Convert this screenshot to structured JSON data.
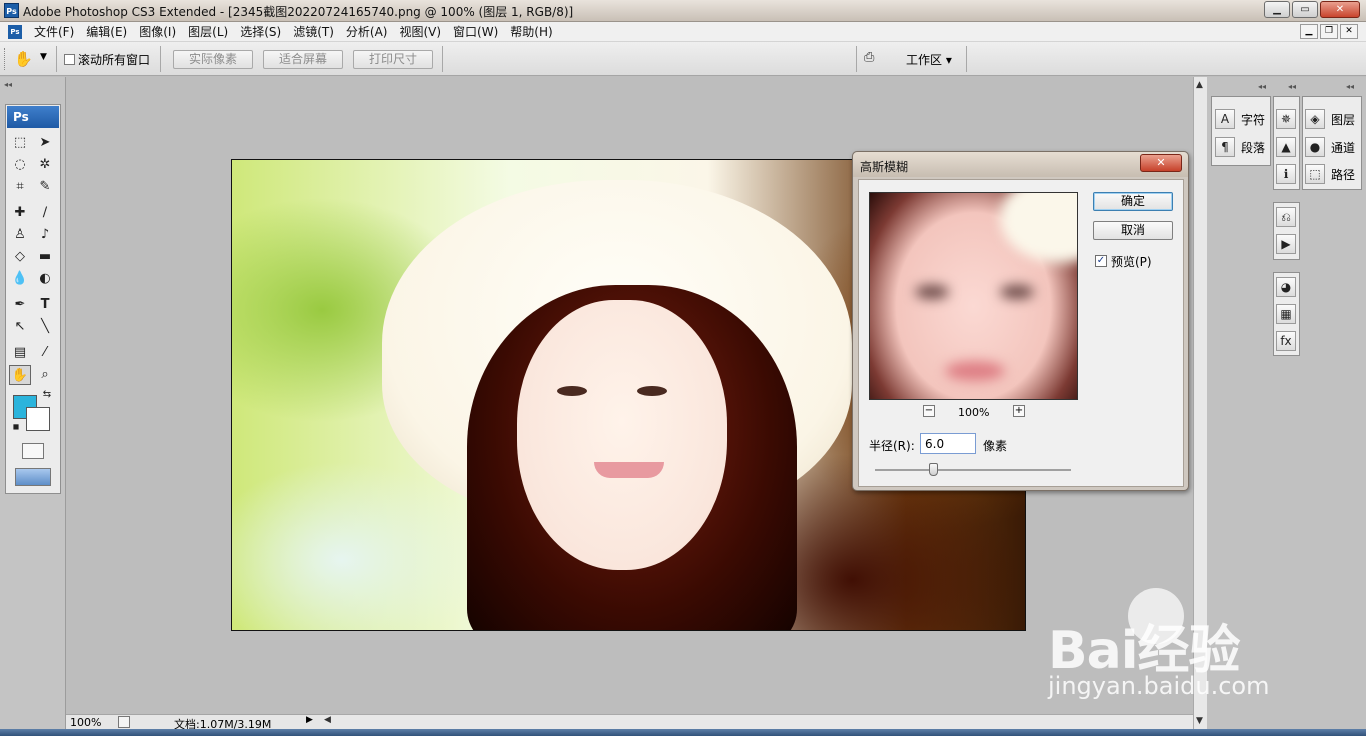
{
  "window": {
    "title": "Adobe Photoshop CS3 Extended - [2345截图20220724165740.png @ 100% (图层 1, RGB/8)]",
    "logo": "Ps"
  },
  "menu": [
    "文件(F)",
    "编辑(E)",
    "图像(I)",
    "图层(L)",
    "选择(S)",
    "滤镜(T)",
    "分析(A)",
    "视图(V)",
    "窗口(W)",
    "帮助(H)"
  ],
  "options": {
    "scroll_all": "滚动所有窗口",
    "actual_pixels": "实际像素",
    "fit_screen": "适合屏幕",
    "print_size": "打印尺寸",
    "workspace": "工作区 ▾"
  },
  "toolbox": {
    "title": "Ps",
    "foreground_color": "#2bb4dc",
    "background_color": "#ffffff"
  },
  "status": {
    "zoom": "100%",
    "doc": "文档:1.07M/3.19M"
  },
  "panels": {
    "character": "字符",
    "paragraph": "段落",
    "layers": "图层",
    "channels": "通道",
    "paths": "路径"
  },
  "dialog": {
    "title": "高斯模糊",
    "ok": "确定",
    "cancel": "取消",
    "preview_label": "预览(P)",
    "preview_checked": true,
    "zoom": "100%",
    "radius_label": "半径(R):",
    "radius_value": "6.0",
    "radius_unit": "像素",
    "radius_slider_fraction": 0.3
  },
  "watermark": {
    "brand": "Bai经验",
    "url": "jingyan.baidu.com"
  }
}
